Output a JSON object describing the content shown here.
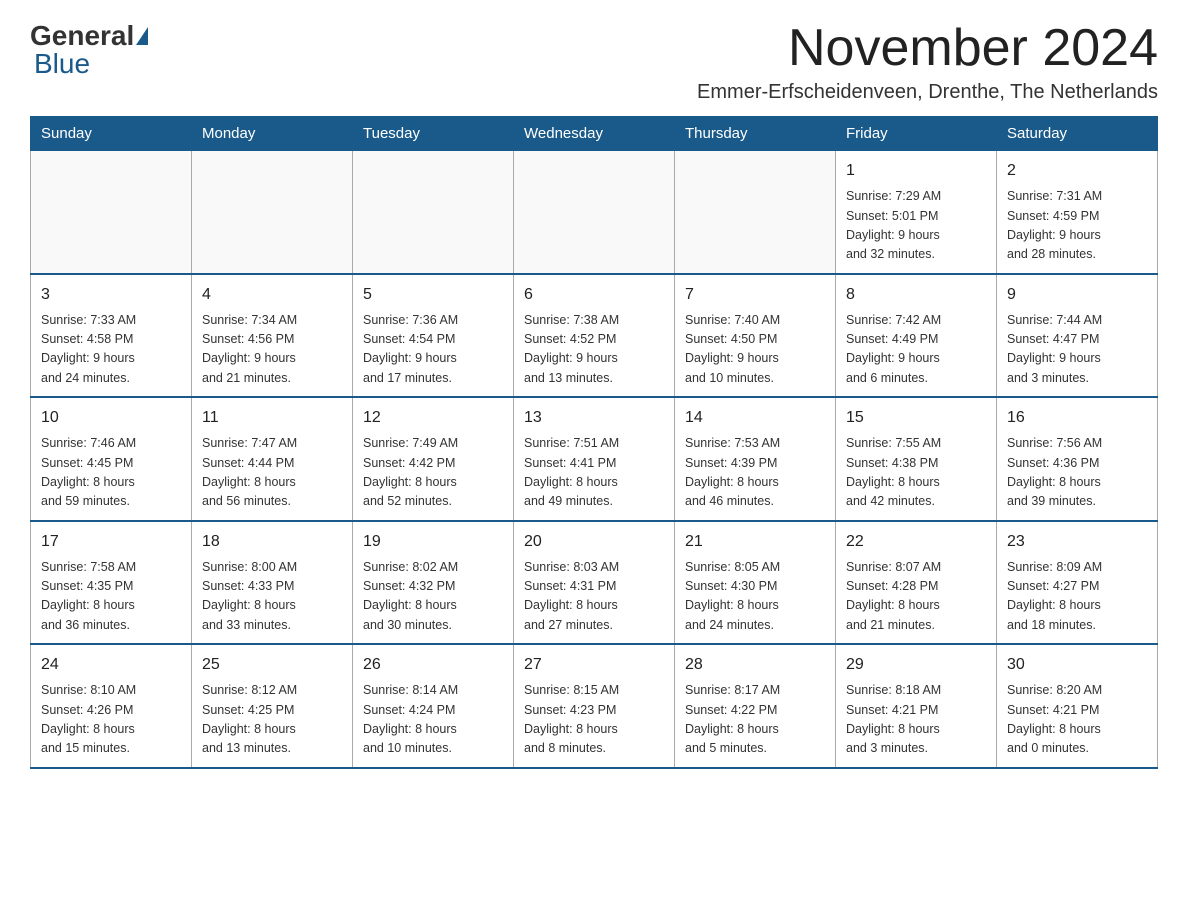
{
  "header": {
    "logo_general": "General",
    "logo_blue": "Blue",
    "month_title": "November 2024",
    "location": "Emmer-Erfscheidenveen, Drenthe, The Netherlands"
  },
  "days_of_week": [
    "Sunday",
    "Monday",
    "Tuesday",
    "Wednesday",
    "Thursday",
    "Friday",
    "Saturday"
  ],
  "weeks": [
    [
      {
        "day": "",
        "info": ""
      },
      {
        "day": "",
        "info": ""
      },
      {
        "day": "",
        "info": ""
      },
      {
        "day": "",
        "info": ""
      },
      {
        "day": "",
        "info": ""
      },
      {
        "day": "1",
        "info": "Sunrise: 7:29 AM\nSunset: 5:01 PM\nDaylight: 9 hours\nand 32 minutes."
      },
      {
        "day": "2",
        "info": "Sunrise: 7:31 AM\nSunset: 4:59 PM\nDaylight: 9 hours\nand 28 minutes."
      }
    ],
    [
      {
        "day": "3",
        "info": "Sunrise: 7:33 AM\nSunset: 4:58 PM\nDaylight: 9 hours\nand 24 minutes."
      },
      {
        "day": "4",
        "info": "Sunrise: 7:34 AM\nSunset: 4:56 PM\nDaylight: 9 hours\nand 21 minutes."
      },
      {
        "day": "5",
        "info": "Sunrise: 7:36 AM\nSunset: 4:54 PM\nDaylight: 9 hours\nand 17 minutes."
      },
      {
        "day": "6",
        "info": "Sunrise: 7:38 AM\nSunset: 4:52 PM\nDaylight: 9 hours\nand 13 minutes."
      },
      {
        "day": "7",
        "info": "Sunrise: 7:40 AM\nSunset: 4:50 PM\nDaylight: 9 hours\nand 10 minutes."
      },
      {
        "day": "8",
        "info": "Sunrise: 7:42 AM\nSunset: 4:49 PM\nDaylight: 9 hours\nand 6 minutes."
      },
      {
        "day": "9",
        "info": "Sunrise: 7:44 AM\nSunset: 4:47 PM\nDaylight: 9 hours\nand 3 minutes."
      }
    ],
    [
      {
        "day": "10",
        "info": "Sunrise: 7:46 AM\nSunset: 4:45 PM\nDaylight: 8 hours\nand 59 minutes."
      },
      {
        "day": "11",
        "info": "Sunrise: 7:47 AM\nSunset: 4:44 PM\nDaylight: 8 hours\nand 56 minutes."
      },
      {
        "day": "12",
        "info": "Sunrise: 7:49 AM\nSunset: 4:42 PM\nDaylight: 8 hours\nand 52 minutes."
      },
      {
        "day": "13",
        "info": "Sunrise: 7:51 AM\nSunset: 4:41 PM\nDaylight: 8 hours\nand 49 minutes."
      },
      {
        "day": "14",
        "info": "Sunrise: 7:53 AM\nSunset: 4:39 PM\nDaylight: 8 hours\nand 46 minutes."
      },
      {
        "day": "15",
        "info": "Sunrise: 7:55 AM\nSunset: 4:38 PM\nDaylight: 8 hours\nand 42 minutes."
      },
      {
        "day": "16",
        "info": "Sunrise: 7:56 AM\nSunset: 4:36 PM\nDaylight: 8 hours\nand 39 minutes."
      }
    ],
    [
      {
        "day": "17",
        "info": "Sunrise: 7:58 AM\nSunset: 4:35 PM\nDaylight: 8 hours\nand 36 minutes."
      },
      {
        "day": "18",
        "info": "Sunrise: 8:00 AM\nSunset: 4:33 PM\nDaylight: 8 hours\nand 33 minutes."
      },
      {
        "day": "19",
        "info": "Sunrise: 8:02 AM\nSunset: 4:32 PM\nDaylight: 8 hours\nand 30 minutes."
      },
      {
        "day": "20",
        "info": "Sunrise: 8:03 AM\nSunset: 4:31 PM\nDaylight: 8 hours\nand 27 minutes."
      },
      {
        "day": "21",
        "info": "Sunrise: 8:05 AM\nSunset: 4:30 PM\nDaylight: 8 hours\nand 24 minutes."
      },
      {
        "day": "22",
        "info": "Sunrise: 8:07 AM\nSunset: 4:28 PM\nDaylight: 8 hours\nand 21 minutes."
      },
      {
        "day": "23",
        "info": "Sunrise: 8:09 AM\nSunset: 4:27 PM\nDaylight: 8 hours\nand 18 minutes."
      }
    ],
    [
      {
        "day": "24",
        "info": "Sunrise: 8:10 AM\nSunset: 4:26 PM\nDaylight: 8 hours\nand 15 minutes."
      },
      {
        "day": "25",
        "info": "Sunrise: 8:12 AM\nSunset: 4:25 PM\nDaylight: 8 hours\nand 13 minutes."
      },
      {
        "day": "26",
        "info": "Sunrise: 8:14 AM\nSunset: 4:24 PM\nDaylight: 8 hours\nand 10 minutes."
      },
      {
        "day": "27",
        "info": "Sunrise: 8:15 AM\nSunset: 4:23 PM\nDaylight: 8 hours\nand 8 minutes."
      },
      {
        "day": "28",
        "info": "Sunrise: 8:17 AM\nSunset: 4:22 PM\nDaylight: 8 hours\nand 5 minutes."
      },
      {
        "day": "29",
        "info": "Sunrise: 8:18 AM\nSunset: 4:21 PM\nDaylight: 8 hours\nand 3 minutes."
      },
      {
        "day": "30",
        "info": "Sunrise: 8:20 AM\nSunset: 4:21 PM\nDaylight: 8 hours\nand 0 minutes."
      }
    ]
  ]
}
